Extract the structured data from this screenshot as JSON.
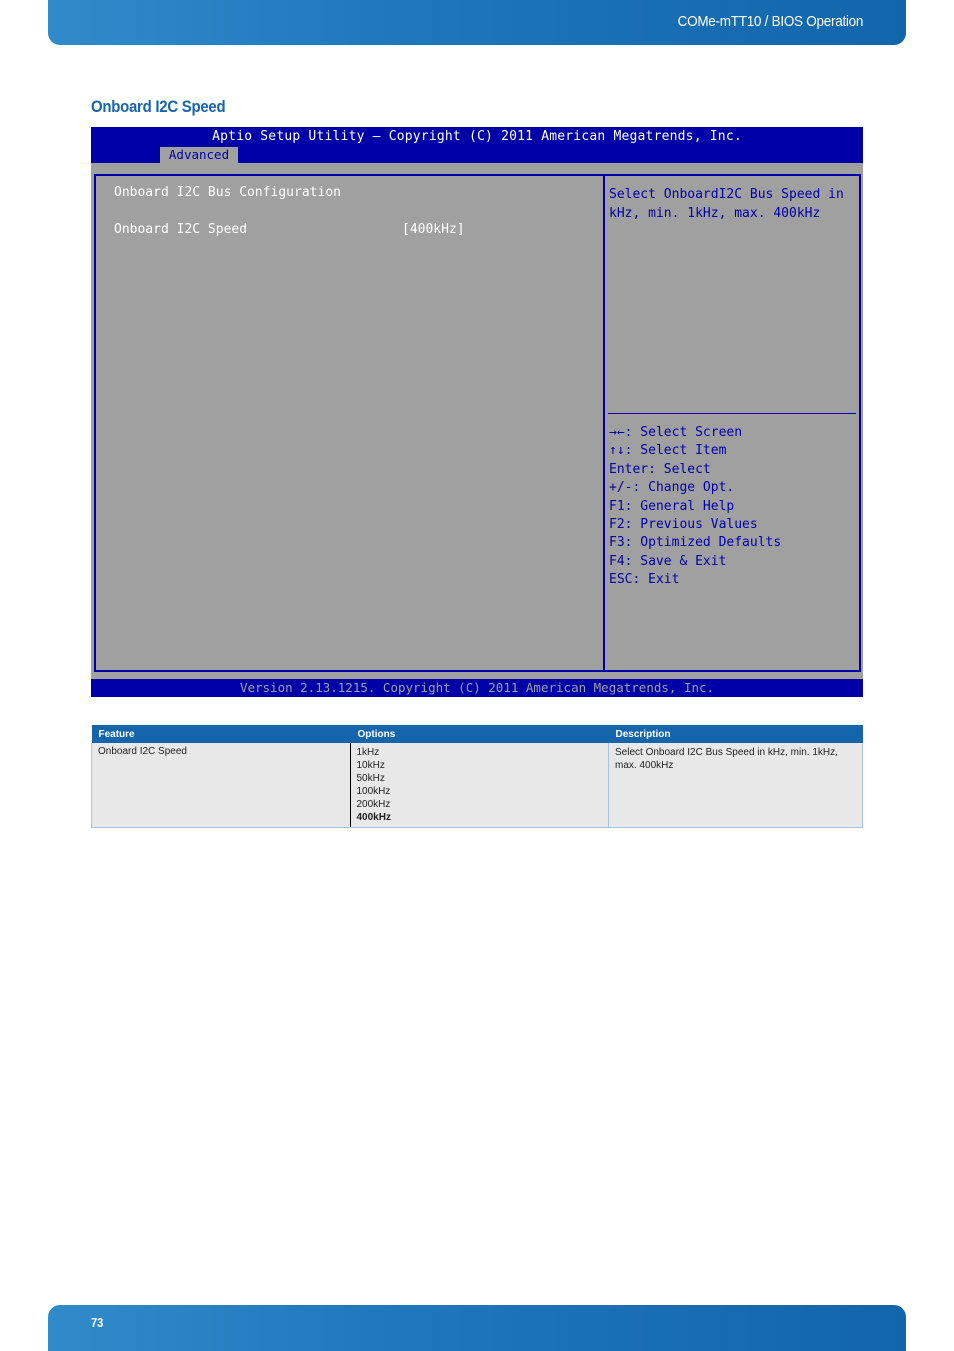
{
  "header": {
    "title": "COMe-mTT10 / BIOS Operation"
  },
  "section": {
    "title": "Onboard I2C Speed"
  },
  "bios": {
    "title": "Aptio Setup Utility – Copyright (C) 2011 American Megatrends, Inc.",
    "active_tab": "Advanced",
    "main": {
      "heading": "Onboard I2C Bus Configuration",
      "items": [
        {
          "label": "Onboard I2C Speed",
          "value": "[400kHz]"
        }
      ]
    },
    "help_text": "Select OnboardI2C Bus Speed in kHz, min. 1kHz, max. 400kHz",
    "keys": [
      "→←: Select Screen",
      "↑↓: Select Item",
      "Enter: Select",
      "+/-: Change Opt.",
      "F1: General Help",
      "F2: Previous Values",
      "F3: Optimized Defaults",
      "F4: Save & Exit",
      "ESC: Exit"
    ],
    "version": "Version 2.13.1215. Copyright (C) 2011 American Megatrends, Inc.",
    "colors": {
      "blue": "#0000a8",
      "gray": "#a0a0a0",
      "white": "#ffffff"
    }
  },
  "table": {
    "headers": [
      "Feature",
      "Options",
      "Description"
    ],
    "rows": [
      {
        "feature": "Onboard I2C Speed",
        "options": [
          "1kHz",
          "10kHz",
          "50kHz",
          "100kHz",
          "200kHz",
          "400kHz"
        ],
        "default_option": "400kHz",
        "description": "Select Onboard I2C Bus Speed in kHz, min. 1kHz, max. 400kHz"
      }
    ]
  },
  "footer": {
    "page_number": "73"
  },
  "colors": {
    "brand_blue": "#1565ac",
    "title_blue": "#1565b0"
  }
}
